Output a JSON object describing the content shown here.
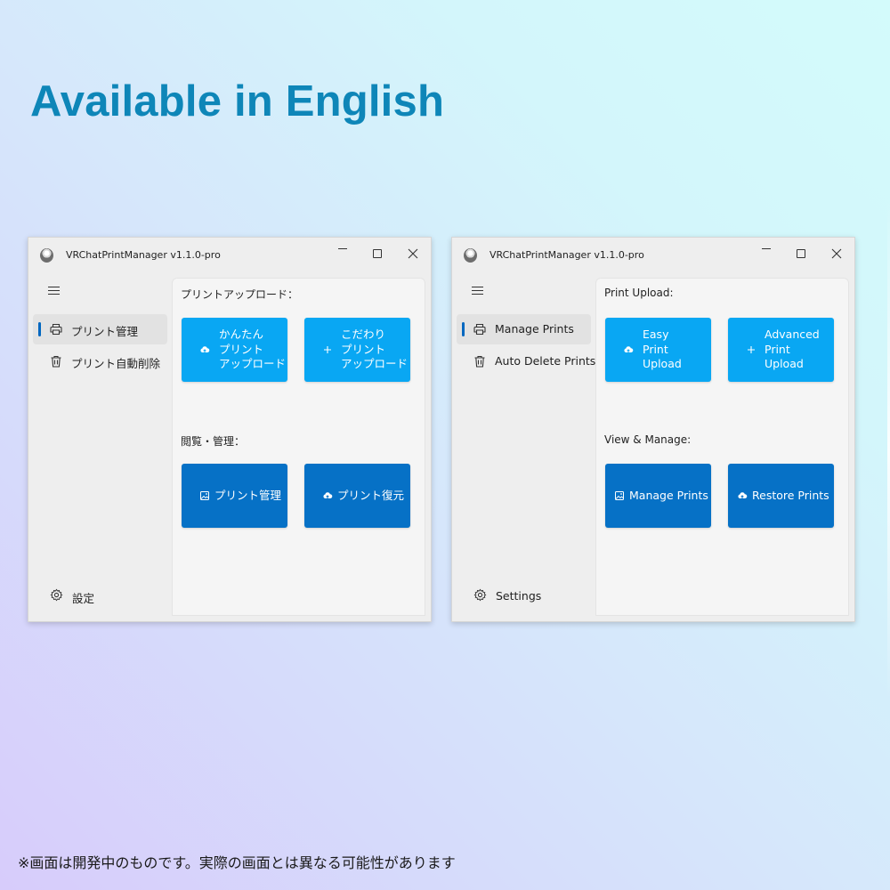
{
  "headline": "Available in English",
  "disclaimer": "※画面は開発中のものです。実際の画面とは異なる可能性があります",
  "windows": [
    {
      "title": "VRChatPrintManager v1.1.0-pro",
      "nav": [
        {
          "label": "プリント管理",
          "icon": "printer-icon",
          "active": true
        },
        {
          "label": "プリント自動削除",
          "icon": "trash-icon",
          "active": false
        }
      ],
      "settings_label": "設定",
      "upload_section_label": "プリントアップロード：",
      "manage_section_label": "閲覧・管理：",
      "buttons": {
        "easy_upload": [
          "かんたん",
          "プリント",
          "アップロード"
        ],
        "advanced_upload": [
          "こだわり",
          "プリント",
          "アップロード"
        ],
        "manage": "プリント管理",
        "restore": "プリント復元"
      }
    },
    {
      "title": "VRChatPrintManager v1.1.0-pro",
      "nav": [
        {
          "label": "Manage Prints",
          "icon": "printer-icon",
          "active": true
        },
        {
          "label": "Auto Delete Prints",
          "icon": "trash-icon",
          "active": false
        }
      ],
      "settings_label": "Settings",
      "upload_section_label": "Print Upload:",
      "manage_section_label": "View & Manage:",
      "buttons": {
        "easy_upload": [
          "Easy",
          "Print",
          "Upload"
        ],
        "advanced_upload": [
          "Advanced",
          "Print",
          "Upload"
        ],
        "manage": "Manage Prints",
        "restore": "Restore Prints"
      }
    }
  ],
  "colors": {
    "headline": "#0e86b8",
    "button_light": "#09a7f3",
    "button_dark": "#0671c6",
    "nav_indicator": "#0067c0"
  }
}
